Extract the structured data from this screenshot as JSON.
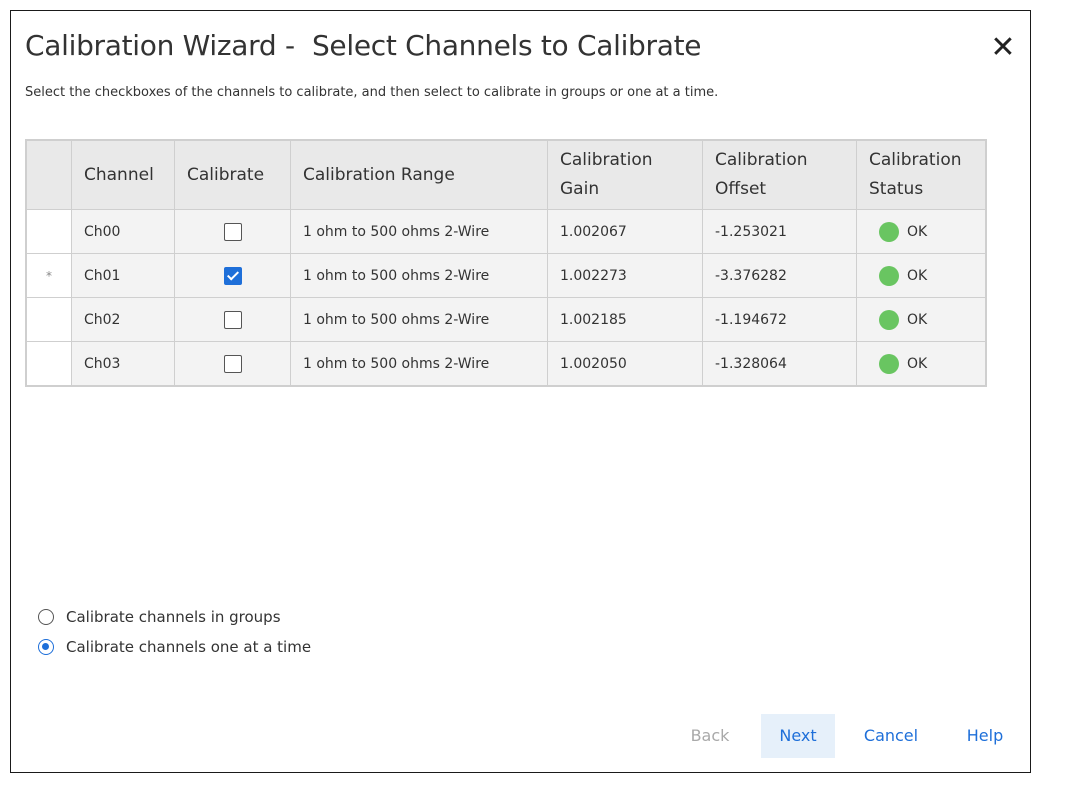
{
  "dialog": {
    "title": "Calibration Wizard -  Select Channels to Calibrate",
    "close_symbol": "✕",
    "instructions": "Select the checkboxes of the channels to calibrate, and then select to calibrate in groups or one at a time."
  },
  "table": {
    "headers": {
      "channel": "Channel",
      "calibrate": "Calibrate",
      "range": "Calibration Range",
      "gain_line1": "Calibration",
      "gain_line2": "Gain",
      "offset_line1": "Calibration",
      "offset_line2": "Offset",
      "status_line1": "Calibration",
      "status_line2": "Status"
    },
    "rows": [
      {
        "marker": "",
        "channel": "Ch00",
        "calibrate": false,
        "range": "1 ohm to 500 ohms 2-Wire",
        "gain": "1.002067",
        "offset": "-1.253021",
        "status": "OK"
      },
      {
        "marker": "*",
        "channel": "Ch01",
        "calibrate": true,
        "range": "1 ohm to 500 ohms 2-Wire",
        "gain": "1.002273",
        "offset": "-3.376282",
        "status": "OK"
      },
      {
        "marker": "",
        "channel": "Ch02",
        "calibrate": false,
        "range": "1 ohm to 500 ohms 2-Wire",
        "gain": "1.002185",
        "offset": "-1.194672",
        "status": "OK"
      },
      {
        "marker": "",
        "channel": "Ch03",
        "calibrate": false,
        "range": "1 ohm to 500 ohms 2-Wire",
        "gain": "1.002050",
        "offset": "-1.328064",
        "status": "OK"
      }
    ],
    "status_color": "#69c561"
  },
  "options": {
    "groups_label": "Calibrate channels in groups",
    "one_at_a_time_label": "Calibrate channels one at a time",
    "selected": "one_at_a_time"
  },
  "buttons": {
    "back": "Back",
    "next": "Next",
    "cancel": "Cancel",
    "help": "Help"
  },
  "colors": {
    "accent": "#1e6fd9",
    "disabled": "#a9a9a9",
    "header_bg": "#e9e9e9",
    "ok_status": "#69c561"
  }
}
